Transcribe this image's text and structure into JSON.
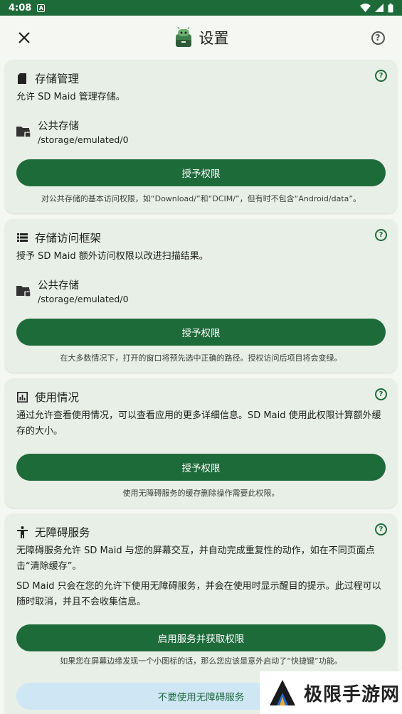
{
  "status_bar": {
    "time": "4:08",
    "notif_icon": "a-icon"
  },
  "toolbar": {
    "title": "设置"
  },
  "cards": [
    {
      "title": "存储管理",
      "desc": "允许 SD Maid 管理存储。",
      "storage_name": "公共存储",
      "storage_path": "/storage/emulated/0",
      "button": "授予权限",
      "note": "对公共存储的基本访问权限，如“Download/”和“DCIM/”，但有时不包含“Android/data”。"
    },
    {
      "title": "存储访问框架",
      "desc": "授予 SD Maid 额外访问权限以改进扫描结果。",
      "storage_name": "公共存储",
      "storage_path": "/storage/emulated/0",
      "button": "授予权限",
      "note": "在大多数情况下，打开的窗口将预先选中正确的路径。授权访问后项目将会变绿。"
    },
    {
      "title": "使用情况",
      "desc": "通过允许查看使用情况，可以查看应用的更多详细信息。SD Maid 使用此权限计算额外缓存的大小。",
      "button": "授予权限",
      "note": "使用无障碍服务的缓存删除操作需要此权限。"
    },
    {
      "title": "无障碍服务",
      "desc": "无障碍服务允许 SD Maid 与您的屏幕交互，并自动完成重复性的动作，如在不同页面点击“清除缓存”。",
      "desc2": "SD Maid 只会在您的允许下使用无障碍服务，并会在使用时显示醒目的提示。此过程可以随时取消，并且不会收集信息。",
      "button": "启用服务并获取权限",
      "note": "如果您在屏幕边缘发现一个小图标的话，那么您应该是意外启动了“快捷键”功能。",
      "button2": "不要使用无障碍服务"
    }
  ],
  "watermark": {
    "text": "极限手游网"
  },
  "colors": {
    "primary": "#1e6b3a",
    "card_bg": "#e8efe6",
    "page_bg": "#f4f7f2",
    "light_button": "#cfe6f5"
  }
}
